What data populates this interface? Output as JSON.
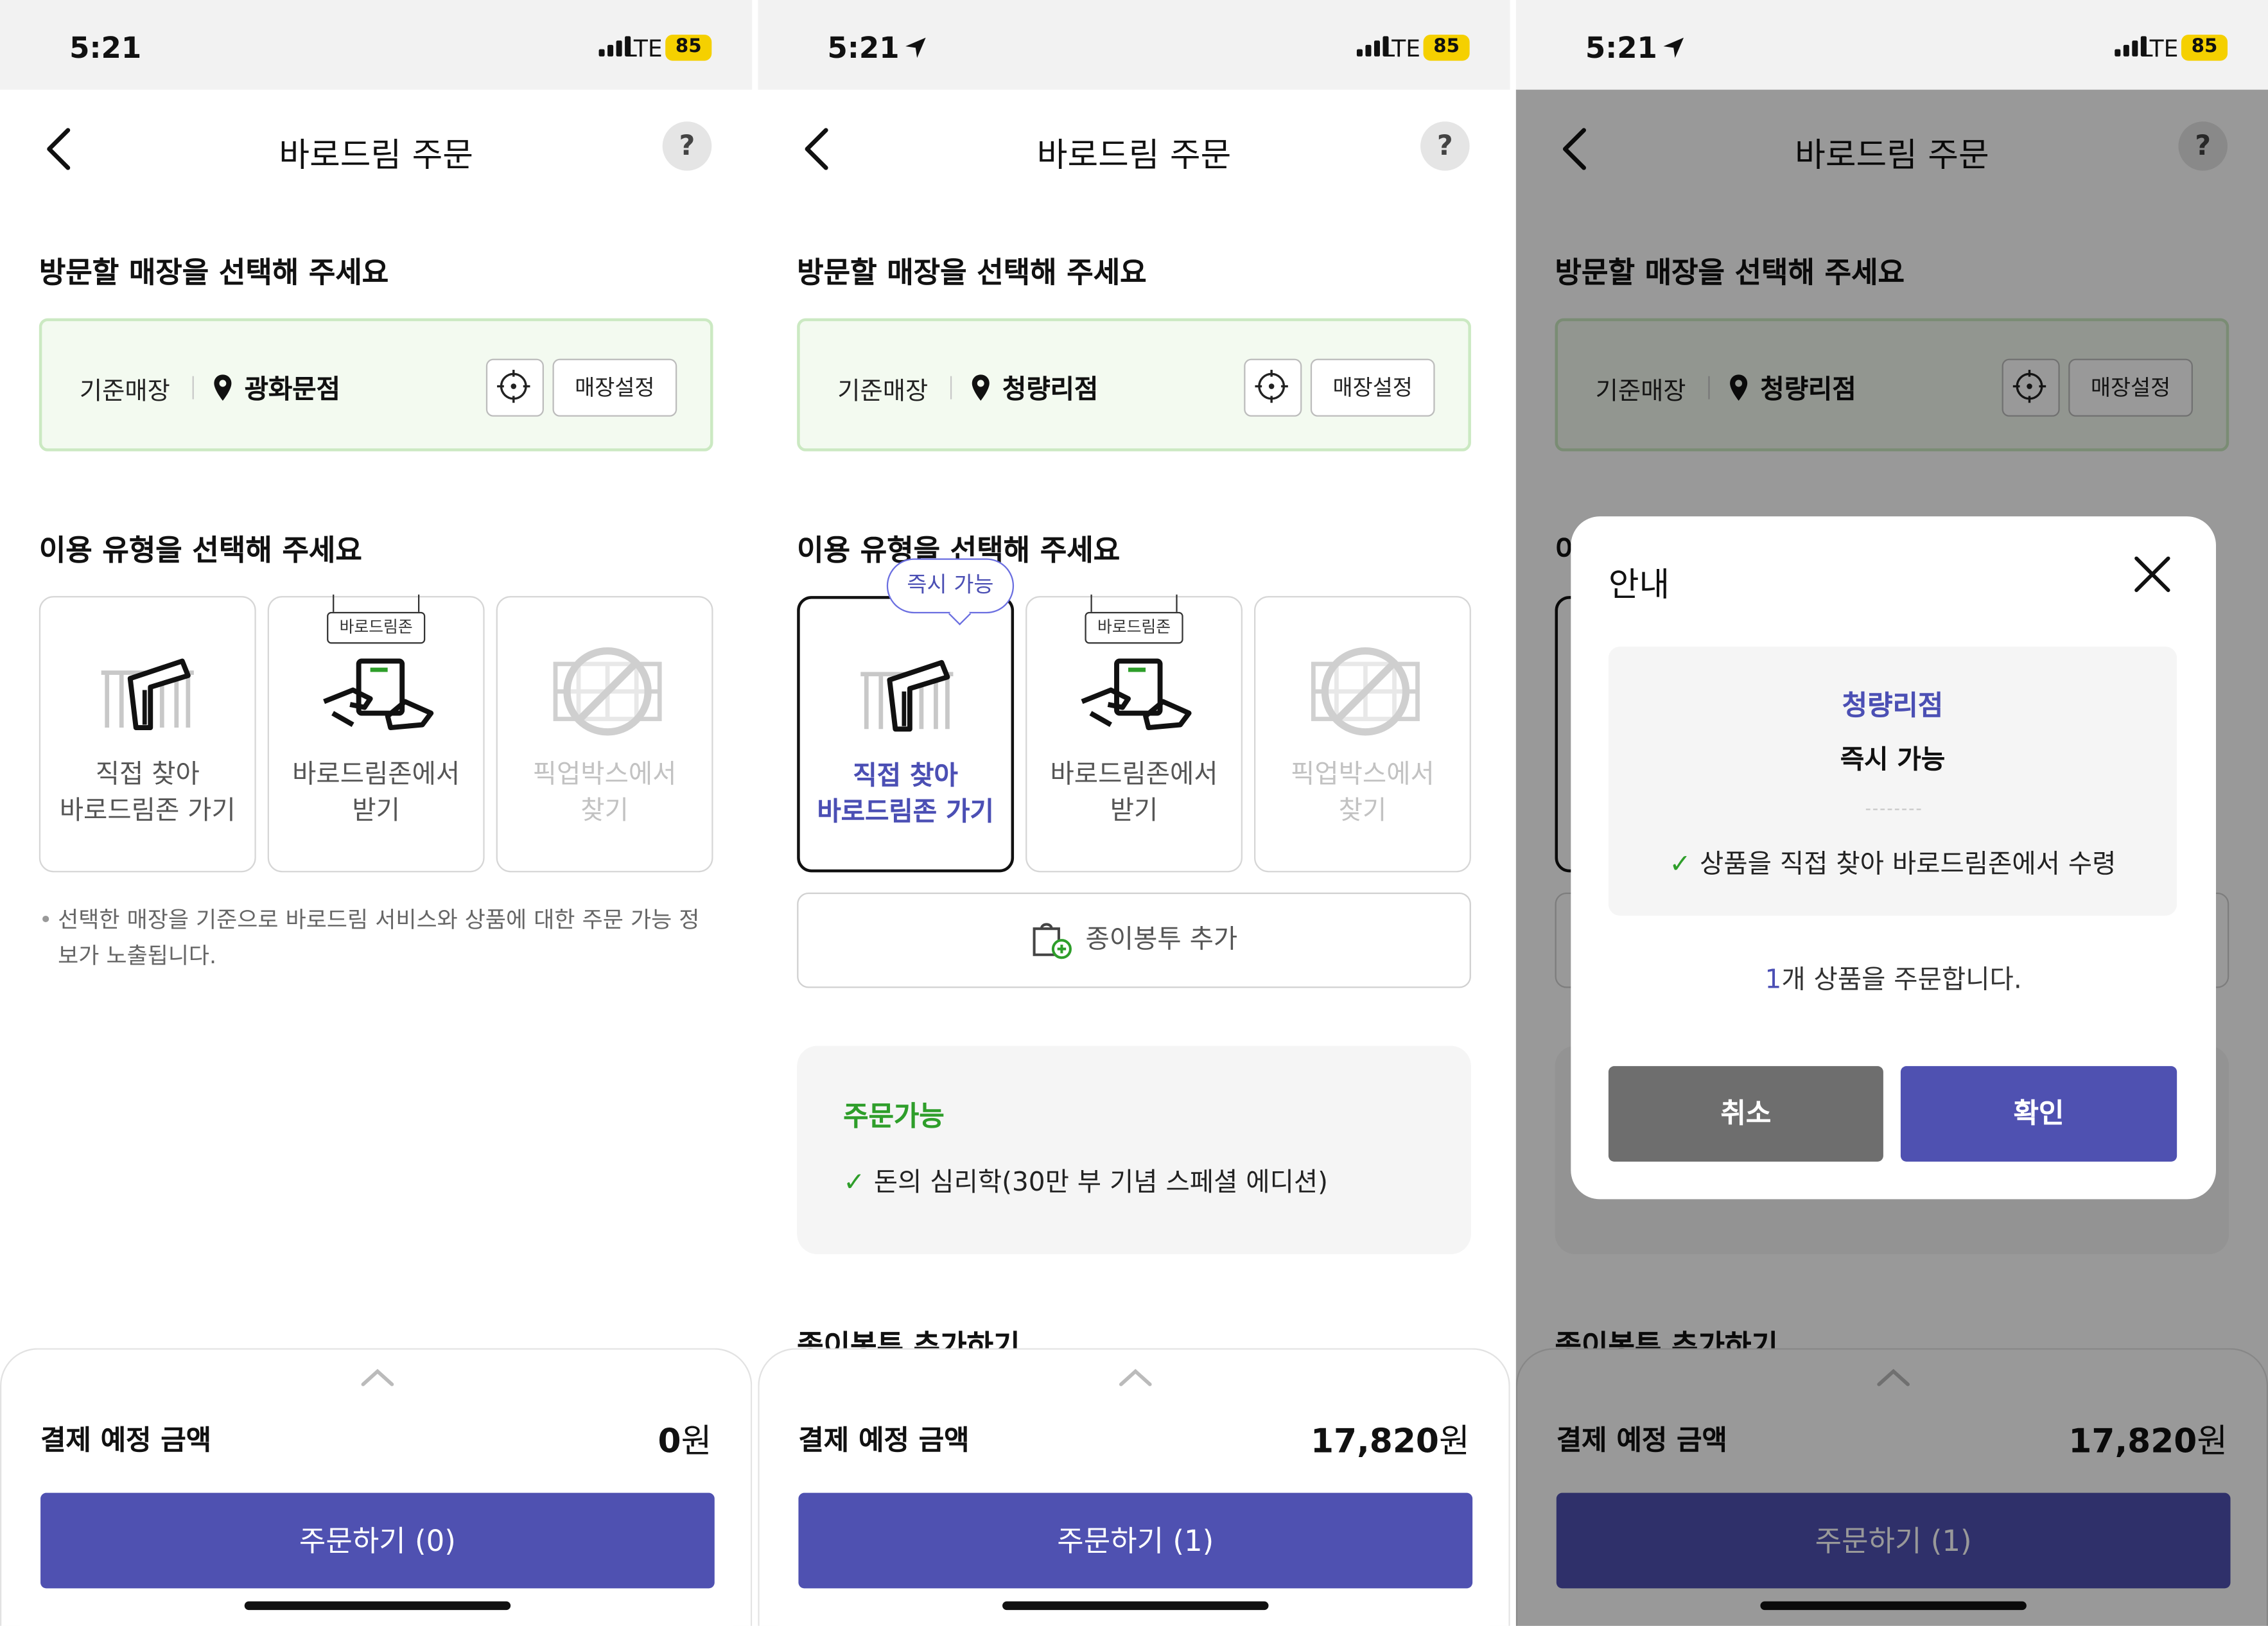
{
  "status": {
    "time": "5:21",
    "network": "LTE",
    "battery": "85"
  },
  "header": {
    "title": "바로드림 주문",
    "help": "?"
  },
  "store_section": {
    "heading": "방문할 매장을 선택해 주세요",
    "label": "기준매장",
    "set_button": "매장설정"
  },
  "type_section": {
    "heading": "이용 유형을 선택해 주세요"
  },
  "options": {
    "direct": {
      "line1": "직접 찾아",
      "line2": "바로드림존 가기"
    },
    "zone": {
      "tag": "바로드림존",
      "line1": "바로드림존에서",
      "line2": "받기"
    },
    "pickup": {
      "line1": "픽업박스에서",
      "line2": "찾기"
    }
  },
  "screens": [
    {
      "store_name": "광화문점",
      "note": "선택한 매장을 기준으로 바로드림 서비스와 상품에 대한 주문 가능 정보가 노출됩니다.",
      "pay_label": "결제 예정 금액",
      "amount": "0",
      "currency": "원",
      "order_button": "주문하기 (0)"
    },
    {
      "store_name": "청량리점",
      "badge": "즉시 가능",
      "bag_button": "종이봉투 추가",
      "avail_title": "주문가능",
      "avail_item": "돈의 심리학(30만 부 기념 스페셜 에디션)",
      "cut_text": "종이봉투 추가하기",
      "pay_label": "결제 예정 금액",
      "amount": "17,820",
      "currency": "원",
      "order_button": "주문하기 (1)"
    },
    {
      "store_name": "청량리점",
      "cut_text": "종이봉투 추가하기",
      "pay_label": "결제 예정 금액",
      "amount": "17,820",
      "currency": "원",
      "order_button": "주문하기 (1)"
    }
  ],
  "dialog": {
    "title": "안내",
    "store": "청량리점",
    "availability": "즉시 가능",
    "description": "상품을 직접 찾아 바로드림존에서 수령",
    "count": "1",
    "count_suffix": "개 상품을 주문합니다.",
    "cancel": "취소",
    "confirm": "확인"
  },
  "colors": {
    "primary": "#4f51b1",
    "accent_text": "#4b4fb4",
    "success": "#2e9e2a",
    "store_box_bg": "#f3faf0",
    "store_box_border": "#cbe9c2",
    "battery": "#f5d000"
  },
  "icons": [
    "cellular-signal-icon",
    "location-arrow-icon",
    "back-chevron-icon",
    "help-icon",
    "location-pin-icon",
    "gps-target-icon",
    "direct-pickup-icon",
    "hand-receive-icon",
    "pickup-box-disabled-icon",
    "paper-bag-add-icon",
    "checkmark-icon",
    "expand-chevron-icon",
    "close-icon"
  ]
}
